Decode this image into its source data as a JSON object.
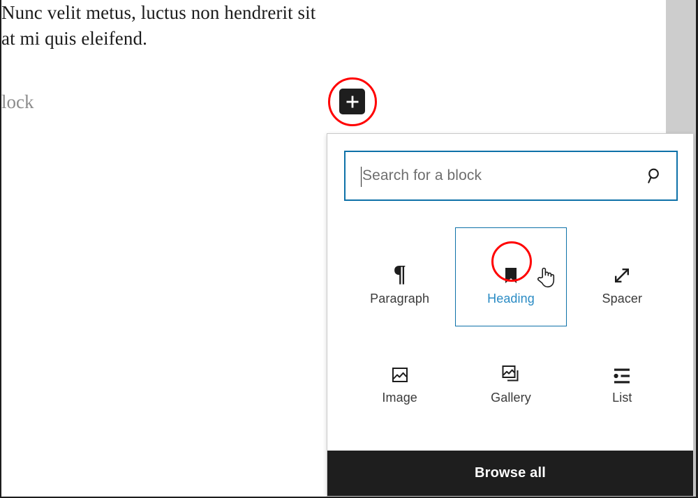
{
  "editor": {
    "paragraph_text": "Nunc velit metus, luctus non hendrerit sit\n at mi quis eleifend.",
    "placeholder_text": "lock",
    "inserter_button_label": "Add block",
    "inserter_icon": "plus-icon"
  },
  "inserter": {
    "search": {
      "placeholder": "Search for a block",
      "value": "",
      "icon": "search-icon"
    },
    "blocks": [
      {
        "label": "Paragraph",
        "icon": "paragraph-icon",
        "selected": false
      },
      {
        "label": "Heading",
        "icon": "heading-bookmark-icon",
        "selected": true
      },
      {
        "label": "Spacer",
        "icon": "spacer-diagonal-arrow-icon",
        "selected": false
      },
      {
        "label": "Image",
        "icon": "image-icon",
        "selected": false
      },
      {
        "label": "Gallery",
        "icon": "gallery-icon",
        "selected": false
      },
      {
        "label": "List",
        "icon": "list-icon",
        "selected": false
      }
    ],
    "browse_all_label": "Browse all"
  },
  "annotations": {
    "inserter_highlight_color": "#ff0000",
    "heading_highlight_color": "#ff0000",
    "selected_accent_color": "#0d71a8",
    "selected_label_color": "#2a8bc4"
  },
  "glyphs": {
    "paragraph_pilcrow": "¶"
  }
}
